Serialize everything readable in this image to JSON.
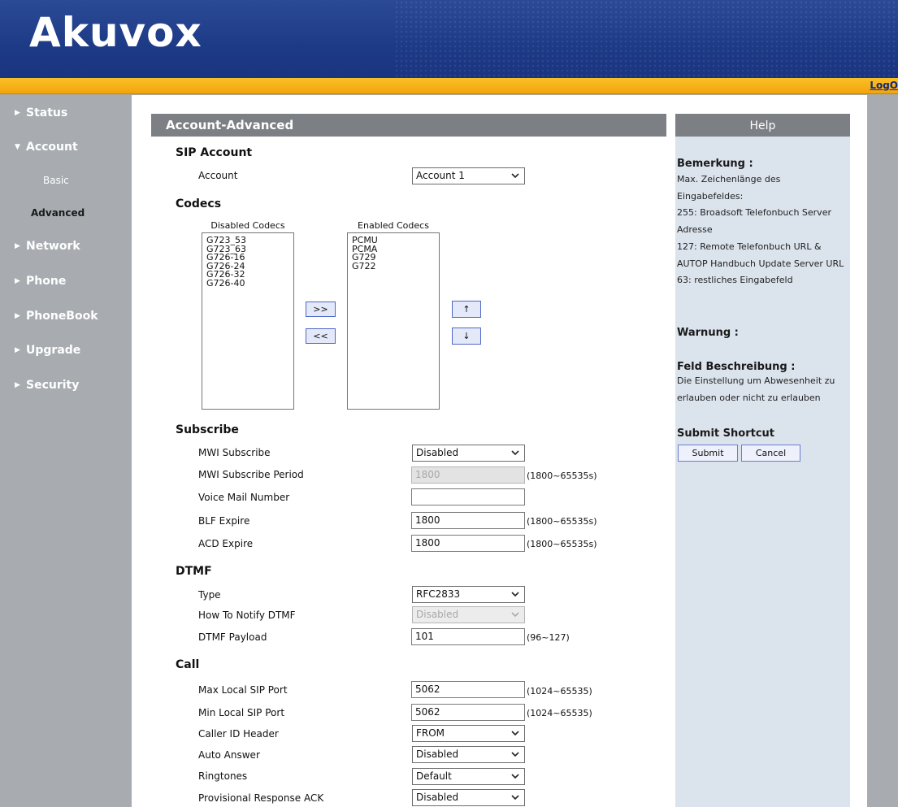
{
  "header": {
    "logo": "Akuvox",
    "logout": "LogO"
  },
  "sidebar": {
    "items": [
      {
        "label": "Status"
      },
      {
        "label": "Account"
      },
      {
        "label": "Network"
      },
      {
        "label": "Phone"
      },
      {
        "label": "PhoneBook"
      },
      {
        "label": "Upgrade"
      },
      {
        "label": "Security"
      }
    ],
    "account_sub": [
      {
        "label": "Basic"
      },
      {
        "label": "Advanced"
      }
    ]
  },
  "panel": {
    "title": "Account-Advanced"
  },
  "sip_account": {
    "section": "SIP Account",
    "account_label": "Account",
    "account_value": "Account 1"
  },
  "codecs": {
    "section": "Codecs",
    "disabled_caption": "Disabled Codecs",
    "enabled_caption": "Enabled Codecs",
    "disabled": [
      "G723_53",
      "G723_63",
      "G726-16",
      "G726-24",
      "G726-32",
      "G726-40"
    ],
    "enabled": [
      "PCMU",
      "PCMA",
      "G729",
      "G722"
    ],
    "move_right": ">>",
    "move_left": "<<",
    "move_up": "↑",
    "move_down": "↓"
  },
  "subscribe": {
    "section": "Subscribe",
    "mwi_label": "MWI Subscribe",
    "mwi_value": "Disabled",
    "period_label": "MWI Subscribe Period",
    "period_value": "1800",
    "period_range": "(1800~65535s)",
    "voicemail_label": "Voice Mail Number",
    "voicemail_value": "",
    "blf_label": "BLF Expire",
    "blf_value": "1800",
    "blf_range": "(1800~65535s)",
    "acd_label": "ACD Expire",
    "acd_value": "1800",
    "acd_range": "(1800~65535s)"
  },
  "dtmf": {
    "section": "DTMF",
    "type_label": "Type",
    "type_value": "RFC2833",
    "notify_label": "How To Notify DTMF",
    "notify_value": "Disabled",
    "payload_label": "DTMF Payload",
    "payload_value": "101",
    "payload_range": "(96~127)"
  },
  "call": {
    "section": "Call",
    "max_port_label": "Max Local SIP Port",
    "max_port_value": "5062",
    "max_port_range": "(1024~65535)",
    "min_port_label": "Min Local SIP Port",
    "min_port_value": "5062",
    "min_port_range": "(1024~65535)",
    "callerid_label": "Caller ID Header",
    "callerid_value": "FROM",
    "autoanswer_label": "Auto Answer",
    "autoanswer_value": "Disabled",
    "ringtones_label": "Ringtones",
    "ringtones_value": "Default",
    "prack_label": "Provisional Response ACK",
    "prack_value": "Disabled"
  },
  "help": {
    "title": "Help",
    "bemerkung_title": "Bemerkung :",
    "bemerkung_text": "Max. Zeichenlänge des Eingabefeldes:\n255: Broadsoft Telefonbuch Server Adresse\n127: Remote Telefonbuch URL & AUTOP Handbuch Update Server URL\n63: restliches Eingabefeld",
    "warnung_title": "Warnung :",
    "feld_title": "Feld Beschreibung :",
    "feld_text": "Die Einstellung um Abwesenheit zu erlauben oder nicht zu erlauben",
    "shortcut_title": "Submit Shortcut",
    "submit_label": "Submit",
    "cancel_label": "Cancel"
  }
}
